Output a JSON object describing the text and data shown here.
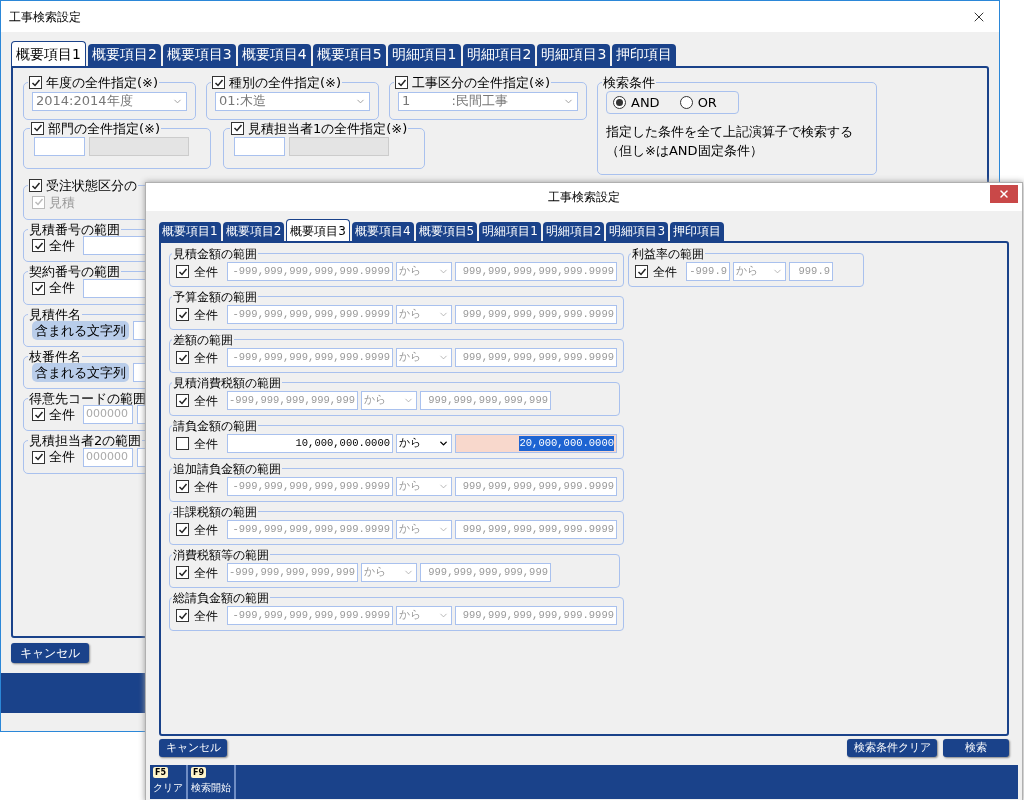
{
  "back_window": {
    "title": "工事検索設定",
    "tabs": [
      {
        "label": "概要項目1",
        "selected": true
      },
      {
        "label": "概要項目2",
        "selected": false
      },
      {
        "label": "概要項目3",
        "selected": false
      },
      {
        "label": "概要項目4",
        "selected": false
      },
      {
        "label": "概要項目5",
        "selected": false
      },
      {
        "label": "明細項目1",
        "selected": false
      },
      {
        "label": "明細項目2",
        "selected": false
      },
      {
        "label": "明細項目3",
        "selected": false
      },
      {
        "label": "押印項目",
        "selected": false
      }
    ],
    "top_groups": [
      {
        "label": "年度の全件指定(※)",
        "checked": true,
        "value": "2014:2014年度"
      },
      {
        "label": "種別の全件指定(※)",
        "checked": true,
        "value": "01:木造"
      },
      {
        "label": "工事区分の全件指定(※)",
        "checked": true,
        "value": "1          :民間工事"
      }
    ],
    "search_condition": {
      "label": "検索条件",
      "options": [
        {
          "label": "AND",
          "selected": true
        },
        {
          "label": "OR",
          "selected": false
        }
      ],
      "note_lines": [
        "指定した条件を全て上記演算子で検索する",
        "（但し※はAND固定条件）"
      ]
    },
    "staff_groups": [
      {
        "label": "部門の全件指定(※)",
        "checked": true
      },
      {
        "label": "見積担当者1の全件指定(※)",
        "checked": true
      }
    ],
    "status_group": {
      "label": "受注状態区分の",
      "checked": true,
      "option": {
        "label": "見積",
        "checked": true
      }
    },
    "left_groups": [
      {
        "label": "見積番号の範囲",
        "kind": "range",
        "checked": true,
        "check_label": "全件"
      },
      {
        "label": "契約番号の範囲",
        "kind": "range",
        "checked": true,
        "check_label": "全件"
      },
      {
        "label": "見積件名",
        "kind": "text",
        "match": "含まれる文字列"
      },
      {
        "label": "枝番件名",
        "kind": "text",
        "match": "含まれる文字列"
      },
      {
        "label": "得意先コードの範囲",
        "kind": "range",
        "checked": true,
        "check_label": "全件",
        "placeholder": "000000"
      },
      {
        "label": "見積担当者2の範囲",
        "kind": "range",
        "checked": true,
        "check_label": "全件",
        "placeholder": "000000"
      }
    ],
    "cancel_button": "キャンセル"
  },
  "front_window": {
    "title": "工事検索設定",
    "tabs": [
      {
        "label": "概要項目1",
        "selected": false
      },
      {
        "label": "概要項目2",
        "selected": false
      },
      {
        "label": "概要項目3",
        "selected": true
      },
      {
        "label": "概要項目4",
        "selected": false
      },
      {
        "label": "概要項目5",
        "selected": false
      },
      {
        "label": "明細項目1",
        "selected": false
      },
      {
        "label": "明細項目2",
        "selected": false
      },
      {
        "label": "明細項目3",
        "selected": false
      },
      {
        "label": "押印項目",
        "selected": false
      }
    ],
    "ranges": [
      {
        "label": "見積金額の範囲",
        "checked": true,
        "check_label": "全件",
        "kind": "long",
        "from": "-999,999,999,999,999.9999",
        "operator": "から",
        "to": "999,999,999,999,999.9999",
        "to_selected": false
      },
      {
        "label": "予算金額の範囲",
        "checked": true,
        "check_label": "全件",
        "kind": "long",
        "from": "-999,999,999,999,999.9999",
        "operator": "から",
        "to": "999,999,999,999,999.9999",
        "to_selected": false
      },
      {
        "label": "差額の範囲",
        "checked": true,
        "check_label": "全件",
        "kind": "long",
        "from": "-999,999,999,999,999.9999",
        "operator": "から",
        "to": "999,999,999,999,999.9999",
        "to_selected": false
      },
      {
        "label": "見積消費税額の範囲",
        "checked": true,
        "check_label": "全件",
        "kind": "short",
        "from": "-999,999,999,999,999",
        "operator": "から",
        "to": "999,999,999,999,999",
        "to_selected": false
      },
      {
        "label": "請負金額の範囲",
        "checked": false,
        "check_label": "全件",
        "kind": "long",
        "from": "10,000,000.0000",
        "operator": "から",
        "to": "20,000,000.0000",
        "to_selected": true
      },
      {
        "label": "追加請負金額の範囲",
        "checked": true,
        "check_label": "全件",
        "kind": "long",
        "from": "-999,999,999,999,999.9999",
        "operator": "から",
        "to": "999,999,999,999,999.9999",
        "to_selected": false
      },
      {
        "label": "非課税額の範囲",
        "checked": true,
        "check_label": "全件",
        "kind": "long",
        "from": "-999,999,999,999,999.9999",
        "operator": "から",
        "to": "999,999,999,999,999.9999",
        "to_selected": false
      },
      {
        "label": "消費税額等の範囲",
        "checked": true,
        "check_label": "全件",
        "kind": "short",
        "from": "-999,999,999,999,999",
        "operator": "から",
        "to": "999,999,999,999,999",
        "to_selected": false
      },
      {
        "label": "総請負金額の範囲",
        "checked": true,
        "check_label": "全件",
        "kind": "long",
        "from": "-999,999,999,999,999.9999",
        "operator": "から",
        "to": "999,999,999,999,999.9999",
        "to_selected": false
      }
    ],
    "profit_range": {
      "label": "利益率の範囲",
      "checked": true,
      "check_label": "全件",
      "kind": "tiny",
      "from": "-999.9",
      "operator": "から",
      "to": "999.9",
      "to_selected": false
    },
    "buttons": [
      {
        "label": "キャンセル"
      },
      {
        "label": "検索条件クリア"
      },
      {
        "label": "検索"
      }
    ],
    "function_keys": [
      {
        "key": "F5",
        "label": "クリア"
      },
      {
        "key": "F9",
        "label": "検索開始"
      }
    ]
  }
}
